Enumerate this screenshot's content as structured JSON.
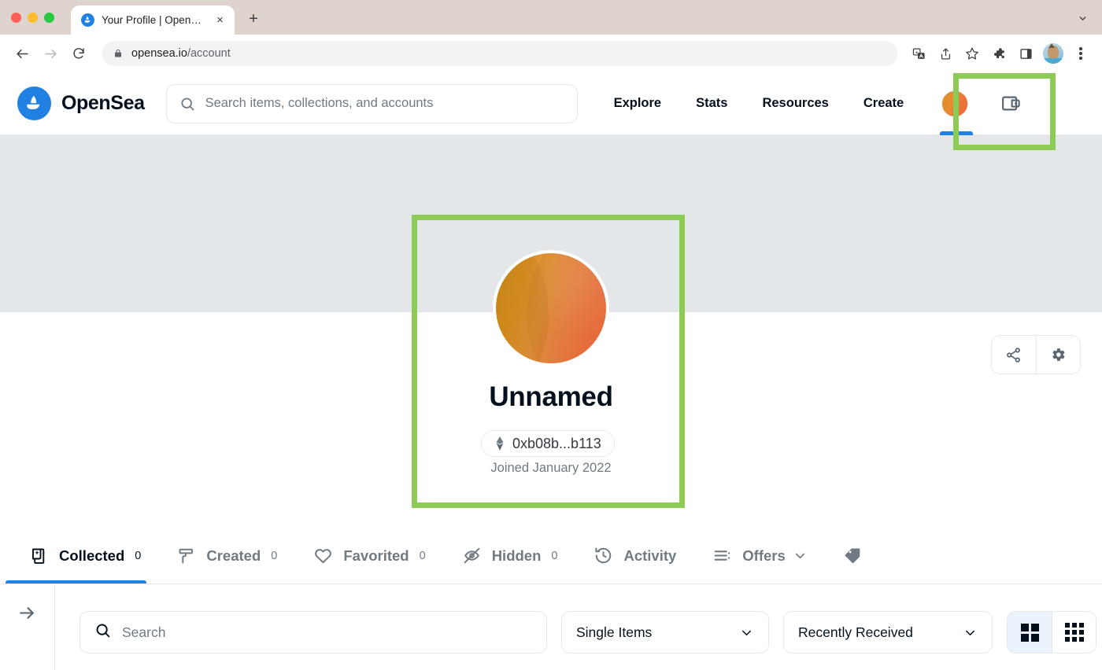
{
  "browser": {
    "tab_title": "Your Profile | OpenSea",
    "tab_favicon": "opensea-logo-icon",
    "close_label": "×",
    "newtab_label": "+",
    "url_host": "opensea.io",
    "url_path": "/account",
    "toolbar_icons": [
      "back-icon",
      "forward-icon",
      "reload-icon",
      "lock-icon",
      "translate-icon",
      "share-icon",
      "bookmark-star-icon",
      "extensions-icon",
      "side-panel-icon",
      "profile-avatar-icon",
      "menu-kebab-icon"
    ]
  },
  "header": {
    "brand": "OpenSea",
    "search": {
      "placeholder": "Search items, collections, and accounts"
    },
    "nav": [
      {
        "label": "Explore"
      },
      {
        "label": "Stats"
      },
      {
        "label": "Resources"
      },
      {
        "label": "Create"
      }
    ],
    "wallet_icon": "wallet-icon"
  },
  "profile": {
    "name": "Unnamed",
    "address": "0xb08b...b113",
    "joined": "Joined January 2022",
    "actions": {
      "share": "share-icon",
      "settings": "gear-icon"
    }
  },
  "tabs": [
    {
      "label": "Collected",
      "count": "0",
      "icon": "collected-icon",
      "active": true
    },
    {
      "label": "Created",
      "count": "0",
      "icon": "paint-roller-icon",
      "active": false
    },
    {
      "label": "Favorited",
      "count": "0",
      "icon": "heart-icon",
      "active": false
    },
    {
      "label": "Hidden",
      "count": "0",
      "icon": "eye-off-icon",
      "active": false
    },
    {
      "label": "Activity",
      "count": "",
      "icon": "history-clock-icon",
      "active": false
    },
    {
      "label": "Offers",
      "count": "",
      "icon": "list-icon",
      "active": false,
      "chevron": true
    }
  ],
  "filters": {
    "toggle_icon": "arrow-right-icon",
    "search_placeholder": "Search",
    "type_select": "Single Items",
    "sort_select": "Recently Received",
    "view_large_icon": "grid-2x2-icon",
    "view_small_icon": "grid-3x3-icon"
  },
  "colors": {
    "accent_blue": "#2081e2",
    "highlight_green": "#8dcb57",
    "banner_gray": "#e3e7ea",
    "text_dark": "#04111d",
    "text_muted": "#707a83"
  }
}
